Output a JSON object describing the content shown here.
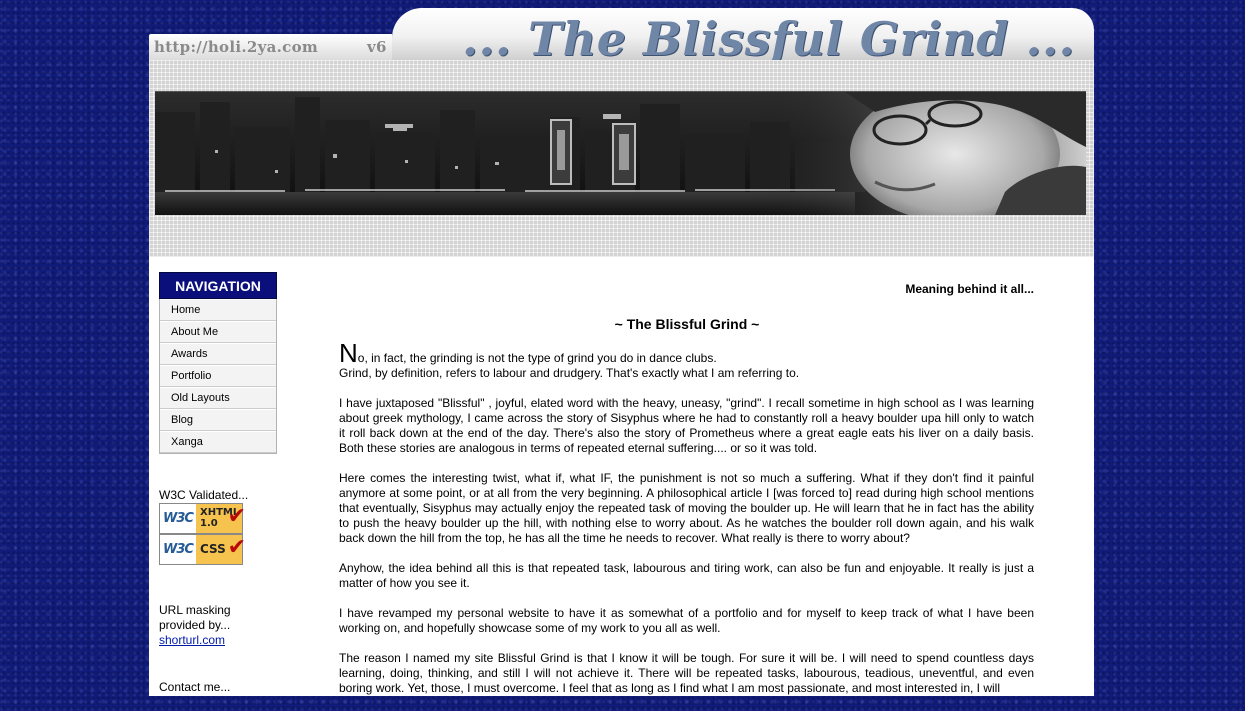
{
  "header": {
    "url": "http://holi.2ya.com",
    "version": "v6",
    "site_title": "... The Blissful Grind ..."
  },
  "nav": {
    "title": "NAVIGATION",
    "items": [
      "Home",
      "About Me",
      "Awards",
      "Portfolio",
      "Old Layouts",
      "Blog",
      "Xanga"
    ]
  },
  "sidebar": {
    "w3c_label": "W3C Validated...",
    "badges": [
      {
        "org": "W3C",
        "standard": "XHTML 1.0"
      },
      {
        "org": "W3C",
        "standard": "CSS"
      }
    ],
    "masking_text_1": "URL masking",
    "masking_text_2": "provided by...",
    "masking_link": "shorturl.com",
    "contact": "Contact me..."
  },
  "content": {
    "tagline": "Meaning behind it all...",
    "title": "~ The Blissful Grind ~",
    "dropcap": "N",
    "p1_a": "o, in fact, the grinding is not the type of grind you do in dance clubs.",
    "p1_b": "Grind, by definition, refers to labour and drudgery. That's exactly what I am referring to.",
    "p2": "I have juxtaposed \"Blissful\" , joyful, elated word with the heavy, uneasy, \"grind\". I recall sometime in high school as I was learning about greek mythology, I came across the story of Sisyphus where he had to constantly roll a heavy boulder upa hill only to watch it roll back down at the end of the day. There's also the story of Prometheus where a great eagle eats his liver on a daily basis. Both these stories are analogous in terms of repeated eternal suffering.... or so it was told.",
    "p3": "Here comes the interesting twist, what if, what IF, the punishment is not so much a suffering. What if they don't find it painful anymore at some point, or at all from the very beginning. A philosophical article I [was forced to] read during high school mentions that eventually, Sisyphus may actually enjoy the repeated task of moving the boulder up. He will learn that he in fact has the ability to push the heavy boulder up the hill, with nothing else to worry about. As he watches the boulder roll down again, and his walk back down the hill from the top, he has all the time he needs to recover. What really is there to worry about?",
    "p4": "Anyhow, the idea behind all this is that repeated task, labourous and tiring work, can also be fun and enjoyable. It really is just a matter of how you see it.",
    "p5": "I have revamped my personal website to have it as somewhat of a portfolio and for myself to keep track of what I have been working on, and hopefully showcase some of my work to you all as well.",
    "p6": "The reason I named my site Blissful Grind is that I know it will be tough. For sure it will be. I will need to spend countless days learning, doing, thinking, and still I will not achieve it. There will be repeated tasks, labourous, teadious, uneventful, and even boring work. Yet, those, I must overcome. I feel that as long as I find what I am most passionate, and most interested in, I will"
  },
  "colors": {
    "background": "#101b7a",
    "nav_header": "#0b0f7c",
    "title_text": "#6f86a7",
    "link": "#001aa8"
  }
}
